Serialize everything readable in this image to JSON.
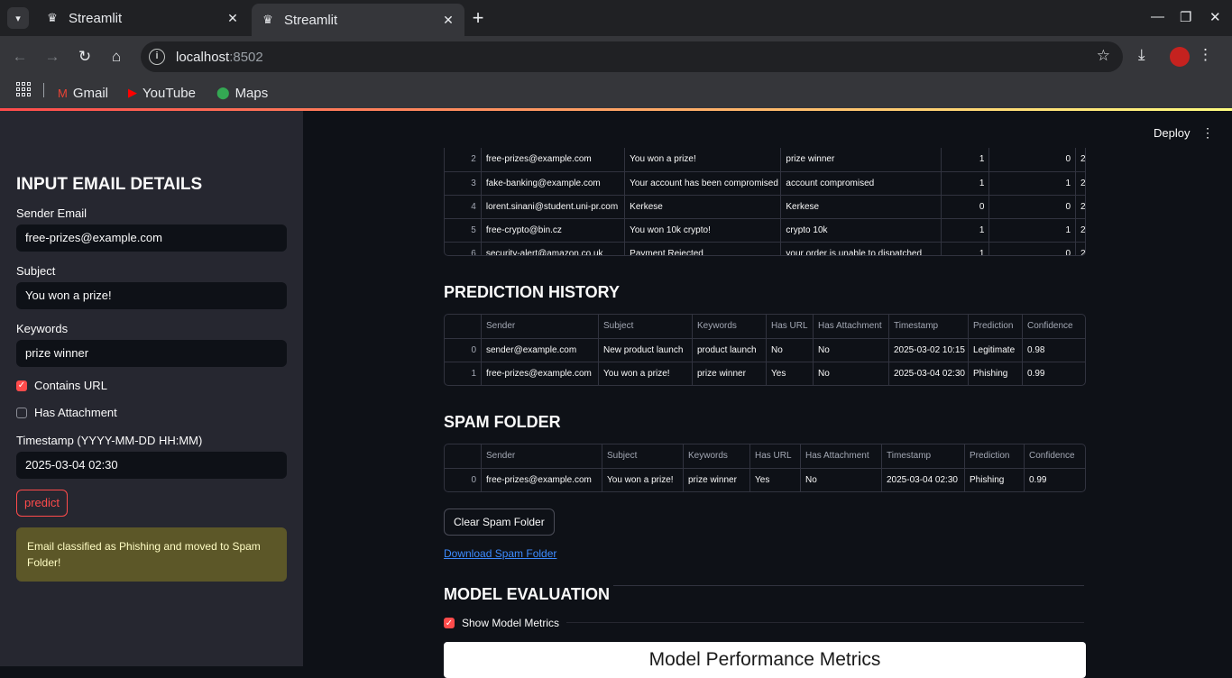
{
  "browser": {
    "tabs": [
      {
        "title": "Streamlit",
        "active": false
      },
      {
        "title": "Streamlit",
        "active": true
      }
    ],
    "url_host": "localhost",
    "url_port": ":8502",
    "bookmarks": [
      "Gmail",
      "YouTube",
      "Maps"
    ]
  },
  "sidebar": {
    "title": "INPUT EMAIL DETAILS",
    "sender_label": "Sender Email",
    "sender_value": "free-prizes@example.com",
    "subject_label": "Subject",
    "subject_value": "You won a prize!",
    "keywords_label": "Keywords",
    "keywords_value": "prize winner",
    "contains_url_label": "Contains URL",
    "contains_url_checked": true,
    "has_attachment_label": "Has Attachment",
    "has_attachment_checked": false,
    "timestamp_label": "Timestamp (YYYY-MM-DD HH:MM)",
    "timestamp_value": "2025-03-04 02:30",
    "predict_label": "predict",
    "alert_text": "Email classified as Phishing and moved to Spam Folder!"
  },
  "header": {
    "deploy_label": "Deploy"
  },
  "dataset_table": {
    "rows": [
      {
        "idx": "2",
        "sender": "free-prizes@example.com",
        "subject": "You won a prize!",
        "keywords": "prize winner",
        "a": "1",
        "b": "0",
        "c": "2"
      },
      {
        "idx": "3",
        "sender": "fake-banking@example.com",
        "subject": "Your account has been compromised",
        "keywords": "account compromised",
        "a": "1",
        "b": "1",
        "c": "2"
      },
      {
        "idx": "4",
        "sender": "lorent.sinani@student.uni-pr.com",
        "subject": "Kerkese",
        "keywords": "Kerkese",
        "a": "0",
        "b": "0",
        "c": "2"
      },
      {
        "idx": "5",
        "sender": "free-crypto@bin.cz",
        "subject": "You won 10k crypto!",
        "keywords": "crypto 10k",
        "a": "1",
        "b": "1",
        "c": "2"
      },
      {
        "idx": "6",
        "sender": "security-alert@amazon.co.uk",
        "subject": "Payment Rejected",
        "keywords": "your order is unable to dispatched",
        "a": "1",
        "b": "0",
        "c": "2"
      }
    ]
  },
  "prediction_history": {
    "title": "PREDICTION HISTORY",
    "columns": [
      "",
      "Sender",
      "Subject",
      "Keywords",
      "Has URL",
      "Has Attachment",
      "Timestamp",
      "Prediction",
      "Confidence"
    ],
    "rows": [
      [
        "0",
        "sender@example.com",
        "New product launch",
        "product launch",
        "No",
        "No",
        "2025-03-02 10:15",
        "Legitimate",
        "0.98"
      ],
      [
        "1",
        "free-prizes@example.com",
        "You won a prize!",
        "prize winner",
        "Yes",
        "No",
        "2025-03-04 02:30",
        "Phishing",
        "0.99"
      ]
    ]
  },
  "spam_folder": {
    "title": "SPAM FOLDER",
    "columns": [
      "",
      "Sender",
      "Subject",
      "Keywords",
      "Has URL",
      "Has Attachment",
      "Timestamp",
      "Prediction",
      "Confidence"
    ],
    "rows": [
      [
        "0",
        "free-prizes@example.com",
        "You won a prize!",
        "prize winner",
        "Yes",
        "No",
        "2025-03-04 02:30",
        "Phishing",
        "0.99"
      ]
    ],
    "clear_label": "Clear Spam Folder",
    "download_label": "Download Spam Folder"
  },
  "model_evaluation": {
    "title": "MODEL EVALUATION",
    "show_metrics_label": "Show Model Metrics",
    "show_metrics_checked": true,
    "figure_title": "Model Performance Metrics"
  },
  "colors": {
    "accent": "#ff4b4b",
    "background": "#0e1117",
    "sidebar": "#262730",
    "alert_bg": "#5c5728",
    "link": "#3d8bff"
  }
}
